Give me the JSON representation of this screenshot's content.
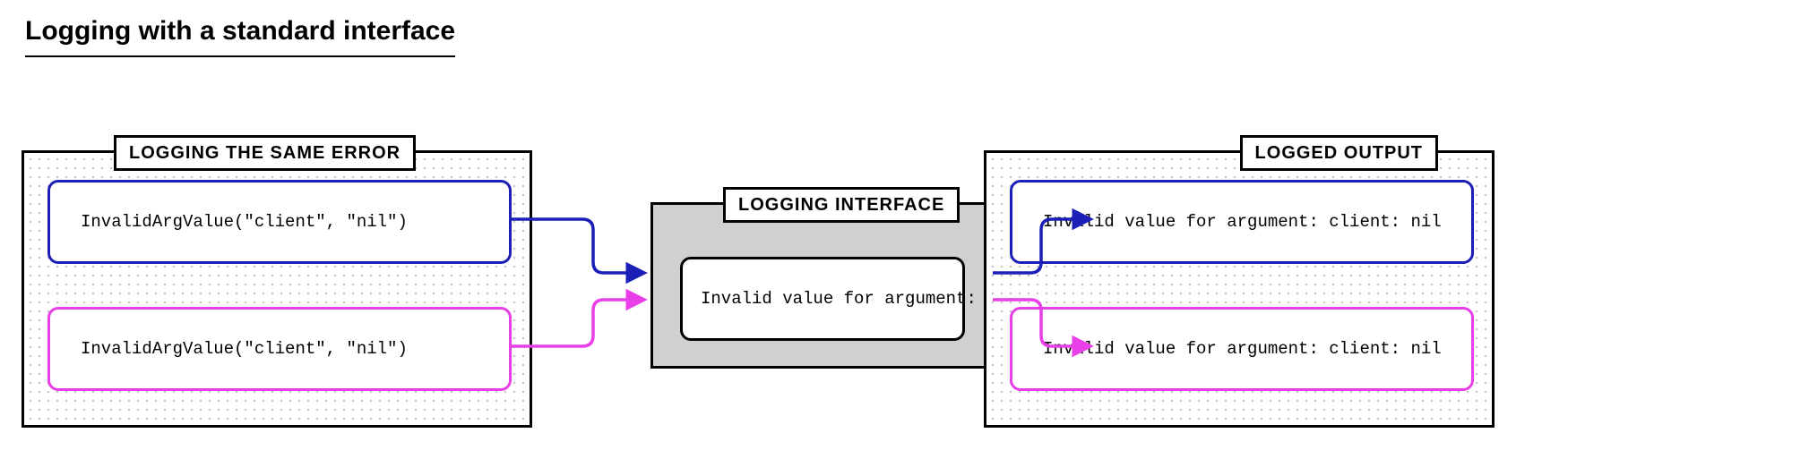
{
  "title": "Logging with a standard interface",
  "panels": {
    "left": {
      "label": "LOGGING THE SAME ERROR",
      "boxes": {
        "blue": "InvalidArgValue(\"client\", \"nil\")",
        "magenta": "InvalidArgValue(\"client\", \"nil\")"
      }
    },
    "middle": {
      "label": "LOGGING INTERFACE",
      "box": "Invalid value for argument: %s: %v"
    },
    "right": {
      "label": "LOGGED OUTPUT",
      "boxes": {
        "blue": "Invalid value for argument: client: nil",
        "magenta": "Invalid value for argument: client: nil"
      }
    }
  },
  "colors": {
    "blue": "#1b1fb8",
    "magenta": "#e83fe8"
  }
}
